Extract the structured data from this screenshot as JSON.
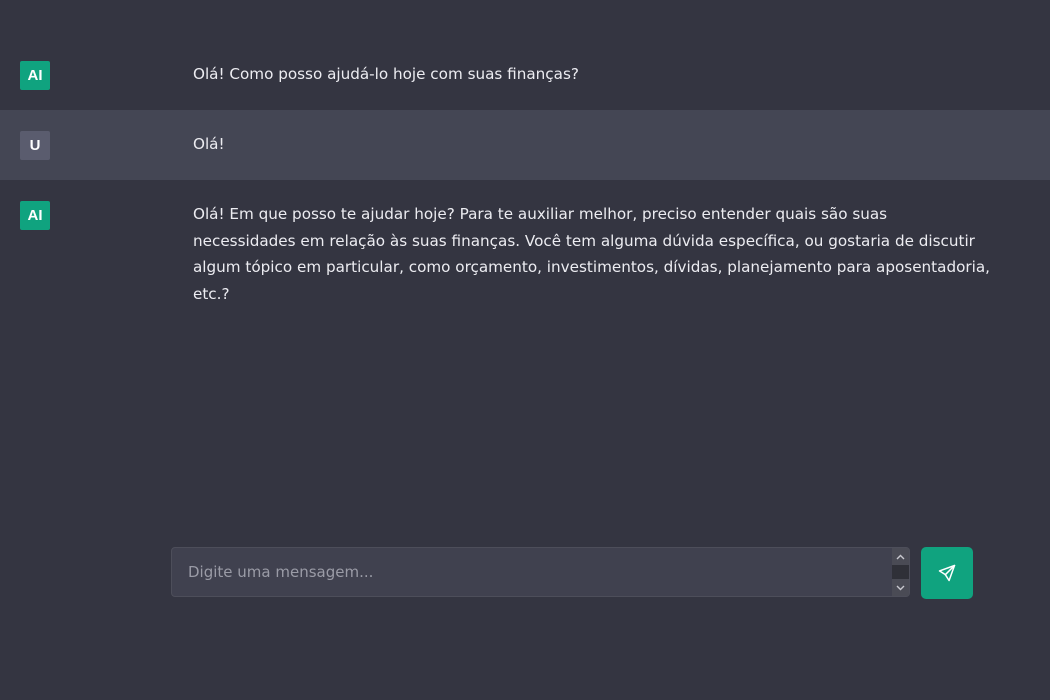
{
  "messages": [
    {
      "role": "ai",
      "avatar": "AI",
      "text": "Olá! Como posso ajudá-lo hoje com suas finanças?"
    },
    {
      "role": "user",
      "avatar": "U",
      "text": "Olá!"
    },
    {
      "role": "ai",
      "avatar": "AI",
      "text": "Olá! Em que posso te ajudar hoje? Para te auxiliar melhor, preciso entender quais são suas necessidades em relação às suas finanças. Você tem alguma dúvida específica, ou gostaria de discutir algum tópico em particular, como orçamento, investimentos, dívidas, planejamento para aposentadoria, etc.?"
    }
  ],
  "composer": {
    "placeholder": "Digite uma mensagem...",
    "value": ""
  },
  "send_button": {
    "icon": "send-icon"
  },
  "colors": {
    "background": "#343541",
    "user_row": "#444654",
    "accent": "#10a37f",
    "user_avatar": "#5a5c6e"
  }
}
